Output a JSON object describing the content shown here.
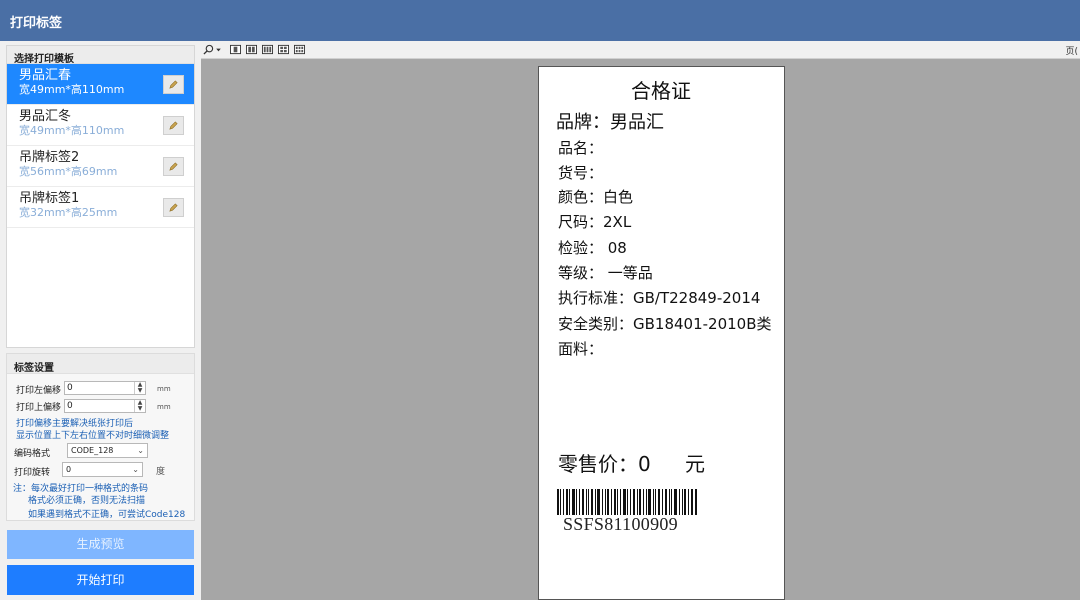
{
  "window": {
    "title": "打印标签"
  },
  "templates": {
    "header": "选择打印模板",
    "items": [
      {
        "name": "男品汇春",
        "size": "宽49mm*高110mm"
      },
      {
        "name": "男品汇冬",
        "size": "宽49mm*高110mm"
      },
      {
        "name": "吊牌标签2",
        "size": "宽56mm*高69mm"
      },
      {
        "name": "吊牌标签1",
        "size": "宽32mm*高25mm"
      }
    ]
  },
  "settings": {
    "header": "标签设置",
    "left_offset_label": "打印左偏移",
    "left_offset_value": "0",
    "top_offset_label": "打印上偏移",
    "top_offset_value": "0",
    "unit_mm": "mm",
    "offset_note_1": "打印偏移主要解决纸张打印后",
    "offset_note_2": "显示位置上下左右位置不对时细微调整",
    "encoding_label": "编码格式",
    "encoding_value": "CODE_128",
    "rotation_label": "打印旋转",
    "rotation_value": "0",
    "rotation_unit": "度",
    "note_1": "注：每次最好打印一种格式的条码",
    "note_2": "格式必须正确，否则无法扫描",
    "note_3": "如果遇到格式不正确，可尝试Code128"
  },
  "buttons": {
    "preview": "生成预览",
    "print": "开始打印"
  },
  "toolbar": {
    "page_label": "页("
  },
  "label_card": {
    "title": "合格证",
    "brand": "品牌：男品汇",
    "product_name": "品名：",
    "item_no": "货号：",
    "color": "颜色：白色",
    "size": "尺码：2XL",
    "inspection": "检验： 08",
    "grade": "等级： 一等品",
    "standard": "执行标准：GB/T22849-2014",
    "safety": "安全类别：GB18401-2010B类",
    "fabric": "面料：",
    "price": "零售价：0",
    "price_unit": "元",
    "barcode_text": "SSFS81100909"
  },
  "colors": {
    "titlebar": "#4a6fa5",
    "selected": "#1e88ff",
    "primary_button": "#1e7dff",
    "disabled_button": "#7fb6ff"
  }
}
